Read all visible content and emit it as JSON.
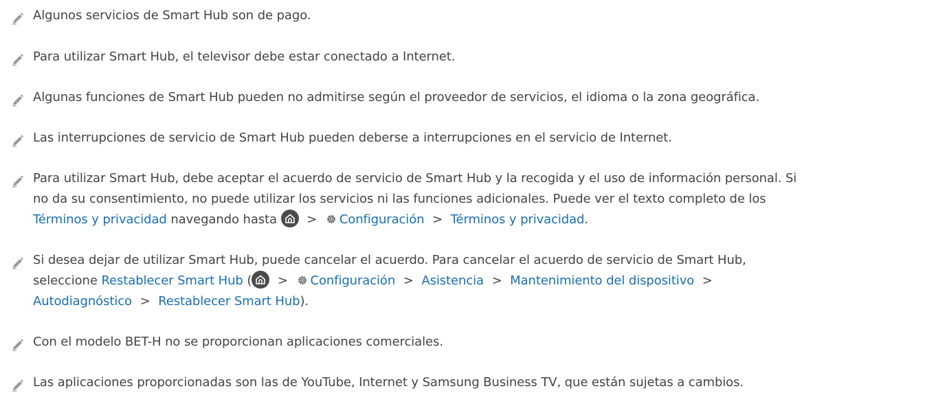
{
  "notes": [
    {
      "text": "Algunos servicios de Smart Hub son de pago."
    },
    {
      "text": "Para utilizar Smart Hub, el televisor debe estar conectado a Internet."
    },
    {
      "text": "Algunas funciones de Smart Hub pueden no admitirse según el proveedor de servicios, el idioma o la zona geográfica."
    },
    {
      "text": "Las interrupciones de servicio de Smart Hub pueden deberse a interrupciones en el servicio de Internet."
    },
    {
      "line1": "Para utilizar Smart Hub, debe aceptar el acuerdo de servicio de Smart Hub y la recogida y el uso de información personal. Si",
      "line2": "no da su consentimiento, no puede utilizar los servicios ni las funciones adicionales. Puede ver el texto completo de los",
      "link_terms": "Términos y privacidad",
      "text_nav": "navegando hasta",
      "link_config": "Configuración",
      "link_terms2": "Términos y privacidad",
      "end": "."
    },
    {
      "line1": "Si desea dejar de utilizar Smart Hub, puede cancelar el acuerdo. Para cancelar el acuerdo de servicio de Smart Hub,",
      "text_select": "seleccione",
      "link_reset": "Restablecer Smart Hub",
      "paren_open": "(",
      "link_config": "Configuración",
      "link_support": "Asistencia",
      "link_maint": "Mantenimiento del dispositivo",
      "link_diag": "Autodiagnóstico",
      "link_reset2": "Restablecer Smart Hub",
      "end": ")."
    },
    {
      "text": "Con el modelo BET-H no se proporcionan aplicaciones comerciales."
    },
    {
      "text": "Las aplicaciones proporcionadas son las de YouTube, Internet y Samsung Business TV, que están sujetas a cambios."
    }
  ],
  "separator": ">",
  "colors": {
    "text": "#444444",
    "link": "#1a6fb4",
    "icon": "#9a9a9a"
  },
  "icons": {
    "note": "pencil-icon",
    "home": "home-icon",
    "settings": "gear-icon"
  }
}
